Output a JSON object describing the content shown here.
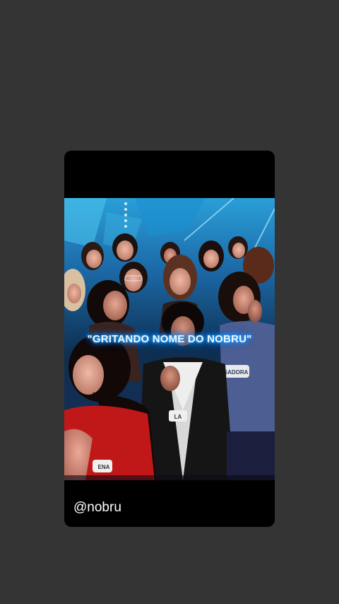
{
  "story": {
    "caption": "\"GRITANDO NOME DO NOBRU\"",
    "handle": "@nobru",
    "badges": {
      "left": "ENA",
      "center": "LA",
      "right": "ISADORA"
    }
  },
  "colors": {
    "page_background": "#343434",
    "card_background": "#000000",
    "caption_glow": "#1e90ff",
    "handle_text": "#ffffff"
  }
}
